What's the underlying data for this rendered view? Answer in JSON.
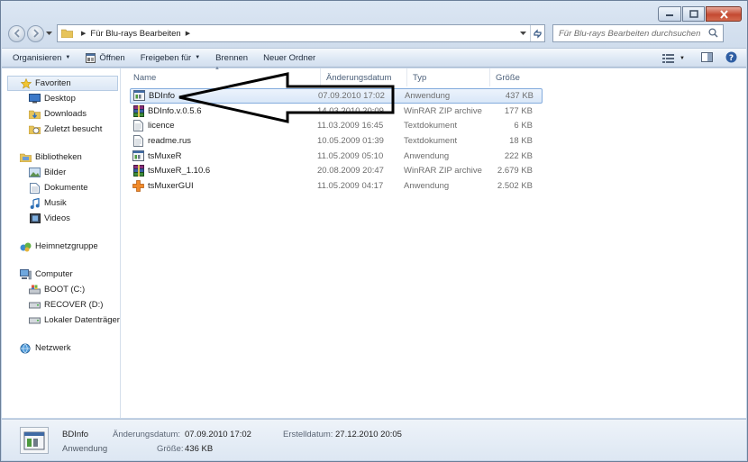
{
  "window": {
    "address": {
      "crumbs": [
        "Für Blu-rays Bearbeiten"
      ]
    },
    "search": {
      "placeholder": "Für Blu-rays Bearbeiten durchsuchen"
    }
  },
  "toolbar": {
    "organize": "Organisieren",
    "open": "Öffnen",
    "share": "Freigeben für",
    "burn": "Brennen",
    "new_folder": "Neuer Ordner"
  },
  "nav": {
    "favorites": {
      "label": "Favoriten",
      "items": [
        "Desktop",
        "Downloads",
        "Zuletzt besucht"
      ]
    },
    "libraries": {
      "label": "Bibliotheken",
      "items": [
        "Bilder",
        "Dokumente",
        "Musik",
        "Videos"
      ]
    },
    "homegroup": {
      "label": "Heimnetzgruppe"
    },
    "computer": {
      "label": "Computer",
      "items": [
        "BOOT (C:)",
        "RECOVER (D:)",
        "Lokaler Datenträger"
      ]
    },
    "network": {
      "label": "Netzwerk"
    }
  },
  "columns": {
    "name": "Name",
    "date": "Änderungsdatum",
    "type": "Typ",
    "size": "Größe"
  },
  "files": [
    {
      "name": "BDInfo",
      "date": "07.09.2010 17:02",
      "type": "Anwendung",
      "size": "437 KB",
      "icon": "app-icon",
      "selected": true
    },
    {
      "name": "BDInfo.v.0.5.6",
      "date": "14.03.2010 20:09",
      "type": "WinRAR ZIP archive",
      "size": "177 KB",
      "icon": "rar-icon"
    },
    {
      "name": "licence",
      "date": "11.03.2009 16:45",
      "type": "Textdokument",
      "size": "6 KB",
      "icon": "text-file-icon"
    },
    {
      "name": "readme.rus",
      "date": "10.05.2009 01:39",
      "type": "Textdokument",
      "size": "18 KB",
      "icon": "text-file-icon"
    },
    {
      "name": "tsMuxeR",
      "date": "11.05.2009 05:10",
      "type": "Anwendung",
      "size": "222 KB",
      "icon": "app-icon"
    },
    {
      "name": "tsMuxeR_1.10.6",
      "date": "20.08.2009 20:47",
      "type": "WinRAR ZIP archive",
      "size": "2.679 KB",
      "icon": "rar-icon"
    },
    {
      "name": "tsMuxerGUI",
      "date": "11.05.2009 04:17",
      "type": "Anwendung",
      "size": "2.502 KB",
      "icon": "gui-app-icon"
    }
  ],
  "details": {
    "name": "BDInfo",
    "kind": "Anwendung",
    "modified_label": "Änderungsdatum:",
    "modified_value": "07.09.2010 17:02",
    "created_label": "Erstelldatum:",
    "created_value": "27.12.2010 20:05",
    "size_label": "Größe:",
    "size_value": "436 KB"
  }
}
